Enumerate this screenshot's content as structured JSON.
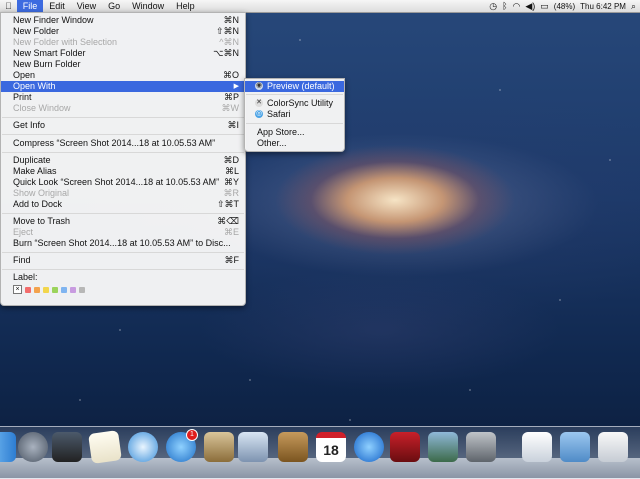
{
  "menubar": {
    "items": [
      "File",
      "Edit",
      "View",
      "Go",
      "Window",
      "Help"
    ],
    "battery": "(48%)",
    "clock": "Thu 6:42 PM"
  },
  "file_menu": {
    "items": [
      {
        "label": "New Finder Window",
        "shortcut": "⌘N"
      },
      {
        "label": "New Folder",
        "shortcut": "⇧⌘N"
      },
      {
        "label": "New Folder with Selection",
        "shortcut": "^⌘N",
        "disabled": true
      },
      {
        "label": "New Smart Folder",
        "shortcut": "⌥⌘N"
      },
      {
        "label": "New Burn Folder",
        "shortcut": ""
      },
      {
        "label": "Open",
        "shortcut": "⌘O"
      },
      {
        "label": "Open With",
        "shortcut": "",
        "submenu": true,
        "highlighted": true
      },
      {
        "label": "Print",
        "shortcut": "⌘P"
      },
      {
        "label": "Close Window",
        "shortcut": "⌘W",
        "disabled": true
      },
      {
        "label": "Get Info",
        "shortcut": "⌘I"
      },
      {
        "label": "Compress “Screen Shot 2014...18 at 10.05.53 AM”",
        "shortcut": ""
      },
      {
        "label": "Duplicate",
        "shortcut": "⌘D"
      },
      {
        "label": "Make Alias",
        "shortcut": "⌘L"
      },
      {
        "label": "Quick Look “Screen Shot 2014...18 at 10.05.53 AM”",
        "shortcut": "⌘Y"
      },
      {
        "label": "Show Original",
        "shortcut": "⌘R",
        "disabled": true
      },
      {
        "label": "Add to Dock",
        "shortcut": "⇧⌘T"
      },
      {
        "label": "Move to Trash",
        "shortcut": "⌘⌫"
      },
      {
        "label": "Eject",
        "shortcut": "⌘E",
        "disabled": true
      },
      {
        "label": "Burn “Screen Shot 2014...18 at 10.05.53 AM” to Disc...",
        "shortcut": ""
      },
      {
        "label": "Find",
        "shortcut": "⌘F"
      }
    ],
    "label_heading": "Label:",
    "label_colors": [
      "#f26c6c",
      "#f3a24d",
      "#f2d64c",
      "#9bd35b",
      "#7fb4f0",
      "#c89be0",
      "#b7b7b7"
    ]
  },
  "open_with_menu": {
    "items": [
      {
        "label": "Preview (default)",
        "icon": "preview-icon",
        "highlighted": true
      },
      {
        "label": "ColorSync Utility",
        "icon": "colorsync-icon"
      },
      {
        "label": "Safari",
        "icon": "safari-icon"
      },
      {
        "label": "App Store...",
        "icon": ""
      },
      {
        "label": "Other...",
        "icon": ""
      }
    ]
  },
  "dock": {
    "apps": [
      "finder",
      "launchpad",
      "mission-control",
      "textedit",
      "safari",
      "app-store",
      "mail",
      "preview",
      "facetime",
      "address-book",
      "ical",
      "itunes",
      "photo-booth",
      "iphoto",
      "system-preferences",
      "downloads",
      "folder",
      "preview-doc"
    ],
    "app_store_badge": "1",
    "ical_date": "18"
  }
}
